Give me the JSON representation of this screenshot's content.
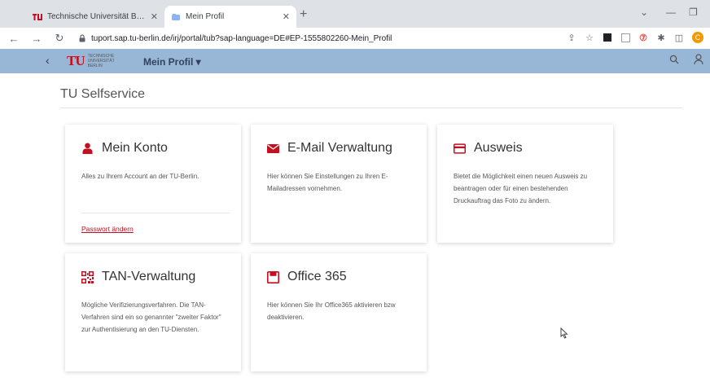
{
  "browser": {
    "tabs": [
      {
        "title": "Technische Universität Berlin",
        "active": false
      },
      {
        "title": "Mein Profil",
        "active": true
      }
    ],
    "new_tab": "+",
    "url": "tuport.sap.tu-berlin.de/irj/portal/tub?sap-language=DE#EP-1555802260-Mein_Profil",
    "profile_initial": "C"
  },
  "appbar": {
    "back": "‹",
    "logo_mark": "TU",
    "logo_lines": [
      "Technische",
      "Universität",
      "Berlin"
    ],
    "title": "Mein Profil ▾"
  },
  "page": {
    "section_title": "TU Selfservice"
  },
  "tiles": [
    {
      "icon": "person-icon",
      "title": "Mein Konto",
      "description": "Alles zu Ihrem Account an der TU-Berlin.",
      "link": "Passwort ändern"
    },
    {
      "icon": "envelope-icon",
      "title": "E-Mail Verwaltung",
      "description": "Hier können Sie Einstellungen zu Ihren E-Mailadressen vornehmen."
    },
    {
      "icon": "id-card-icon",
      "title": "Ausweis",
      "description": "Bietet die Möglichkeit einen neuen Ausweis zu beantragen oder für einen bestehenden Druckauftrag das Foto zu ändern."
    },
    {
      "icon": "qr-code-icon",
      "title": "TAN-Verwaltung",
      "description": "Mögliche Verifizierungsverfahren. Die TAN-Verfahren sind ein so genannter \"zweiter Faktor\" zur Authentisierung an den TU-Diensten."
    },
    {
      "icon": "office-icon",
      "title": "Office 365",
      "description": "Hier können Sie Ihr Office365 aktivieren bzw deaktivieren."
    }
  ],
  "colors": {
    "accent": "#c50e1f",
    "appbar": "#98b7d6"
  }
}
